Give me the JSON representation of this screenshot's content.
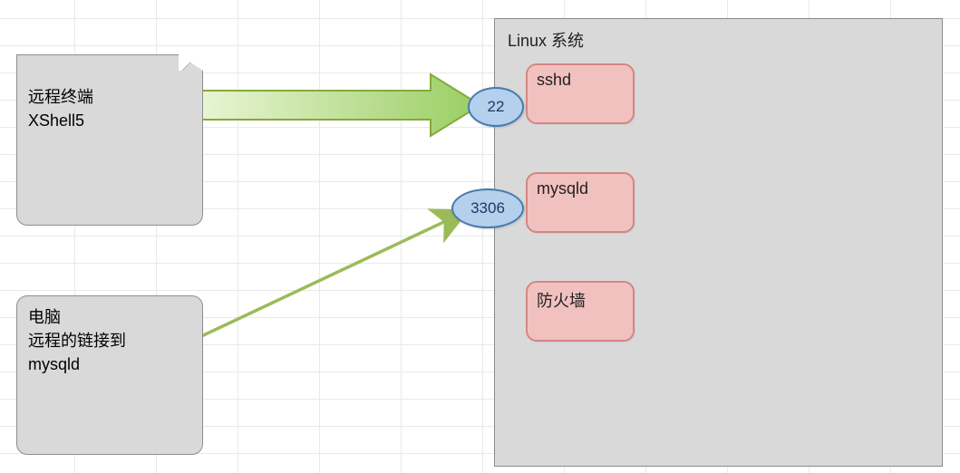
{
  "linux": {
    "title": "Linux 系统",
    "services": {
      "sshd": "sshd",
      "mysqld": "mysqld",
      "firewall": "防火墙"
    }
  },
  "ports": {
    "ssh": "22",
    "mysql": "3306"
  },
  "clients": {
    "terminal": {
      "line1": "远程终端",
      "line2": "XShell5"
    },
    "pc": {
      "line1": "电脑",
      "line2": "远程的链接到",
      "line3": "mysqld"
    }
  },
  "chart_data": {
    "type": "diagram",
    "title": "Linux 系统",
    "nodes": [
      {
        "id": "terminal",
        "label": "远程终端 XShell5",
        "kind": "client"
      },
      {
        "id": "pc",
        "label": "电脑 远程的链接到 mysqld",
        "kind": "client"
      },
      {
        "id": "linux",
        "label": "Linux 系统",
        "kind": "container"
      },
      {
        "id": "sshd",
        "label": "sshd",
        "kind": "service",
        "parent": "linux"
      },
      {
        "id": "mysqld",
        "label": "mysqld",
        "kind": "service",
        "parent": "linux"
      },
      {
        "id": "firewall",
        "label": "防火墙",
        "kind": "service",
        "parent": "linux"
      },
      {
        "id": "port22",
        "label": "22",
        "kind": "port",
        "parent": "linux"
      },
      {
        "id": "port3306",
        "label": "3306",
        "kind": "port",
        "parent": "linux"
      }
    ],
    "edges": [
      {
        "from": "terminal",
        "to": "port22",
        "style": "thick-arrow"
      },
      {
        "from": "pc",
        "to": "port3306",
        "style": "thin-arrow"
      },
      {
        "from": "port22",
        "to": "sshd",
        "style": "adjacent"
      },
      {
        "from": "port3306",
        "to": "mysqld",
        "style": "adjacent"
      }
    ]
  }
}
